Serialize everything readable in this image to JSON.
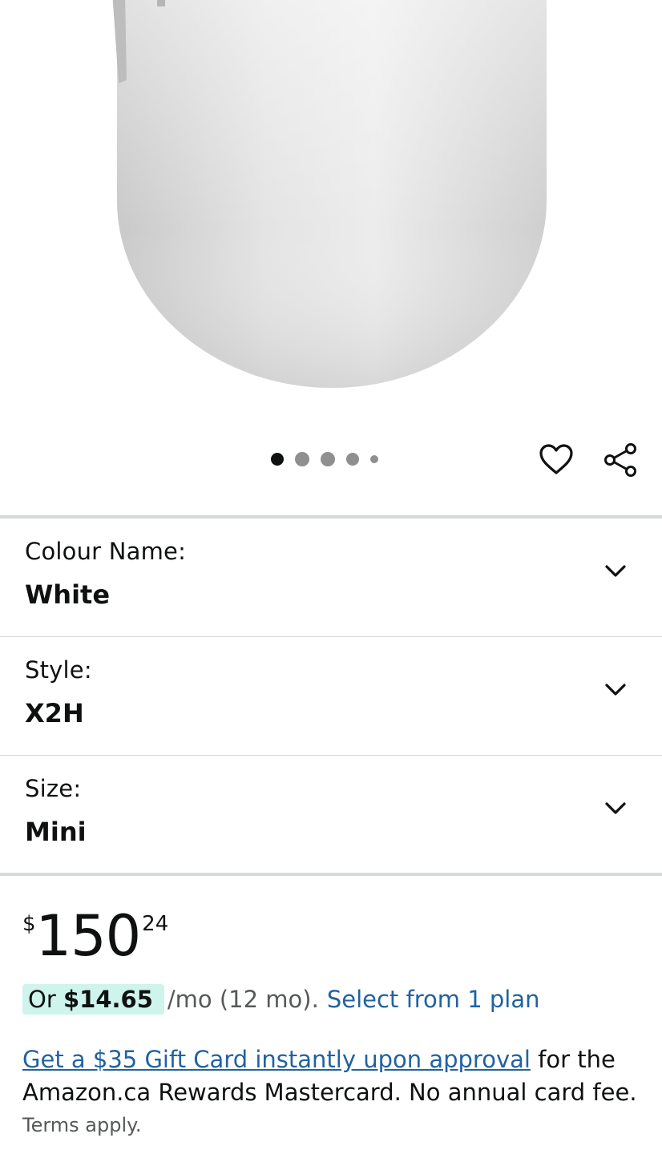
{
  "gallery": {
    "image_alt": "White mouse product image",
    "dot_count": 5,
    "active_dot": 1
  },
  "actions": {
    "wishlist_icon": "heart-icon",
    "share_icon": "share-icon"
  },
  "variations": [
    {
      "label": "Colour Name:",
      "value": "White"
    },
    {
      "label": "Style:",
      "value": "X2H"
    },
    {
      "label": "Size:",
      "value": "Mini"
    }
  ],
  "price": {
    "currency": "$",
    "whole": "150",
    "fraction": "24"
  },
  "installment": {
    "prefix": "Or ",
    "amount": "$14.65",
    "terms": "/mo (12 mo).",
    "link": "Select from 1 plan"
  },
  "promo": {
    "link": "Get a $35 Gift Card instantly upon approval",
    "text": " for the Amazon.ca Rewards Mastercard. No annual card fee.",
    "terms": "Terms apply."
  },
  "colors": {
    "link": "#2162a1",
    "installment_bg": "#cef4ec",
    "separator": "#d5d9d9"
  }
}
